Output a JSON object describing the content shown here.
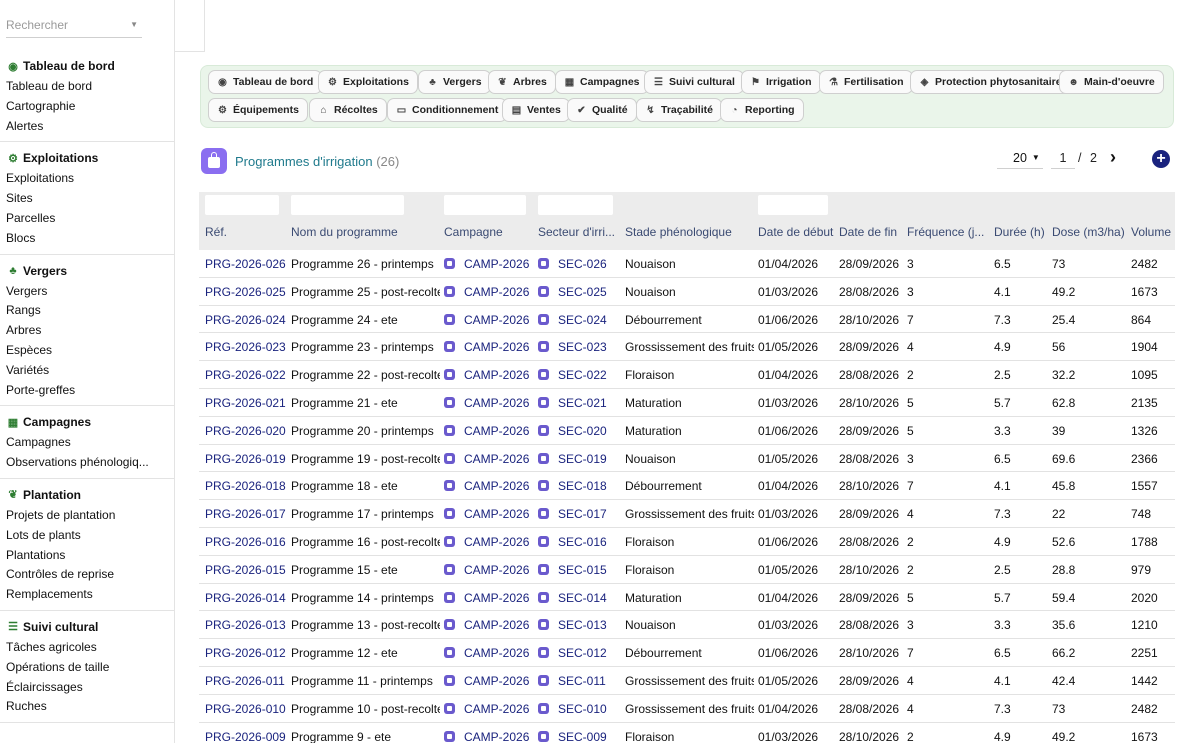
{
  "search": {
    "placeholder": "Rechercher"
  },
  "sidebar": {
    "sections": [
      {
        "title": "Tableau de bord",
        "icon": "dashboard-icon",
        "glyph": "◉",
        "items": [
          "Tableau de bord",
          "Cartographie",
          "Alertes"
        ]
      },
      {
        "title": "Exploitations",
        "icon": "tractor-icon",
        "glyph": "⚙",
        "items": [
          "Exploitations",
          "Sites",
          "Parcelles",
          "Blocs"
        ]
      },
      {
        "title": "Vergers",
        "icon": "tree-icon",
        "glyph": "♣",
        "items": [
          "Vergers",
          "Rangs",
          "Arbres",
          "Espèces",
          "Variétés",
          "Porte-greffes"
        ]
      },
      {
        "title": "Campagnes",
        "icon": "calendar-icon",
        "glyph": "▦",
        "items": [
          "Campagnes",
          "Observations phénologiq..."
        ]
      },
      {
        "title": "Plantation",
        "icon": "seedling-icon",
        "glyph": "❦",
        "items": [
          "Projets de plantation",
          "Lots de plants",
          "Plantations",
          "Contrôles de reprise",
          "Remplacements"
        ]
      },
      {
        "title": "Suivi cultural",
        "icon": "checklist-icon",
        "glyph": "☰",
        "items": [
          "Tâches agricoles",
          "Opérations de taille",
          "Éclaircissages",
          "Ruches"
        ]
      }
    ]
  },
  "modules": [
    {
      "label": "Tableau de bord",
      "icon": "dashboard-icon",
      "glyph": "◉"
    },
    {
      "label": "Exploitations",
      "icon": "tractor-icon",
      "glyph": "⚙"
    },
    {
      "label": "Vergers",
      "icon": "tree-icon",
      "glyph": "♣"
    },
    {
      "label": "Arbres",
      "icon": "seedling-icon",
      "glyph": "❦"
    },
    {
      "label": "Campagnes",
      "icon": "calendar-icon",
      "glyph": "▦"
    },
    {
      "label": "Suivi cultural",
      "icon": "checklist-icon",
      "glyph": "☰"
    },
    {
      "label": "Irrigation",
      "icon": "faucet-icon",
      "glyph": "⚑"
    },
    {
      "label": "Fertilisation",
      "icon": "flask-icon",
      "glyph": "⚗"
    },
    {
      "label": "Protection phytosanitaire",
      "icon": "shield-icon",
      "glyph": "◈"
    },
    {
      "label": "Main-d'oeuvre",
      "icon": "users-icon",
      "glyph": "☻"
    },
    {
      "label": "Équipements",
      "icon": "tractor-icon",
      "glyph": "⚙"
    },
    {
      "label": "Récoltes",
      "icon": "basket-icon",
      "glyph": "⌂"
    },
    {
      "label": "Conditionnement",
      "icon": "box-icon",
      "glyph": "▭"
    },
    {
      "label": "Ventes",
      "icon": "receipt-icon",
      "glyph": "▤"
    },
    {
      "label": "Qualité",
      "icon": "check-double-icon",
      "glyph": "✔"
    },
    {
      "label": "Traçabilité",
      "icon": "route-icon",
      "glyph": "↯"
    },
    {
      "label": "Reporting",
      "icon": "chart-pie-icon",
      "glyph": "◔"
    }
  ],
  "list": {
    "title": "Programmes d'irrigation",
    "count": "(26)",
    "page_size": "20",
    "page_current": "1",
    "page_sep": "/",
    "page_total": "2"
  },
  "table": {
    "columns": [
      "Réf.",
      "Nom du programme",
      "Campagne",
      "Secteur d'irri...",
      "Stade phénologique",
      "Date de début",
      "Date de fin",
      "Fréquence (j...",
      "Durée (h)",
      "Dose (m3/ha)",
      "Volume p"
    ],
    "rows": [
      [
        "PRG-2026-026",
        "Programme 26 - printemps",
        "CAMP-2026",
        "SEC-026",
        "Nouaison",
        "01/04/2026",
        "28/09/2026",
        "3",
        "6.5",
        "73",
        "2482"
      ],
      [
        "PRG-2026-025",
        "Programme 25 - post-recolte",
        "CAMP-2026",
        "SEC-025",
        "Nouaison",
        "01/03/2026",
        "28/08/2026",
        "3",
        "4.1",
        "49.2",
        "1673"
      ],
      [
        "PRG-2026-024",
        "Programme 24 - ete",
        "CAMP-2026",
        "SEC-024",
        "Débourrement",
        "01/06/2026",
        "28/10/2026",
        "7",
        "7.3",
        "25.4",
        "864"
      ],
      [
        "PRG-2026-023",
        "Programme 23 - printemps",
        "CAMP-2026",
        "SEC-023",
        "Grossissement des fruits",
        "01/05/2026",
        "28/09/2026",
        "4",
        "4.9",
        "56",
        "1904"
      ],
      [
        "PRG-2026-022",
        "Programme 22 - post-recolte",
        "CAMP-2026",
        "SEC-022",
        "Floraison",
        "01/04/2026",
        "28/08/2026",
        "2",
        "2.5",
        "32.2",
        "1095"
      ],
      [
        "PRG-2026-021",
        "Programme 21 - ete",
        "CAMP-2026",
        "SEC-021",
        "Maturation",
        "01/03/2026",
        "28/10/2026",
        "5",
        "5.7",
        "62.8",
        "2135"
      ],
      [
        "PRG-2026-020",
        "Programme 20 - printemps",
        "CAMP-2026",
        "SEC-020",
        "Maturation",
        "01/06/2026",
        "28/09/2026",
        "5",
        "3.3",
        "39",
        "1326"
      ],
      [
        "PRG-2026-019",
        "Programme 19 - post-recolte",
        "CAMP-2026",
        "SEC-019",
        "Nouaison",
        "01/05/2026",
        "28/08/2026",
        "3",
        "6.5",
        "69.6",
        "2366"
      ],
      [
        "PRG-2026-018",
        "Programme 18 - ete",
        "CAMP-2026",
        "SEC-018",
        "Débourrement",
        "01/04/2026",
        "28/10/2026",
        "7",
        "4.1",
        "45.8",
        "1557"
      ],
      [
        "PRG-2026-017",
        "Programme 17 - printemps",
        "CAMP-2026",
        "SEC-017",
        "Grossissement des fruits",
        "01/03/2026",
        "28/09/2026",
        "4",
        "7.3",
        "22",
        "748"
      ],
      [
        "PRG-2026-016",
        "Programme 16 - post-recolte",
        "CAMP-2026",
        "SEC-016",
        "Floraison",
        "01/06/2026",
        "28/08/2026",
        "2",
        "4.9",
        "52.6",
        "1788"
      ],
      [
        "PRG-2026-015",
        "Programme 15 - ete",
        "CAMP-2026",
        "SEC-015",
        "Floraison",
        "01/05/2026",
        "28/10/2026",
        "2",
        "2.5",
        "28.8",
        "979"
      ],
      [
        "PRG-2026-014",
        "Programme 14 - printemps",
        "CAMP-2026",
        "SEC-014",
        "Maturation",
        "01/04/2026",
        "28/09/2026",
        "5",
        "5.7",
        "59.4",
        "2020"
      ],
      [
        "PRG-2026-013",
        "Programme 13 - post-recolte",
        "CAMP-2026",
        "SEC-013",
        "Nouaison",
        "01/03/2026",
        "28/08/2026",
        "3",
        "3.3",
        "35.6",
        "1210"
      ],
      [
        "PRG-2026-012",
        "Programme 12 - ete",
        "CAMP-2026",
        "SEC-012",
        "Débourrement",
        "01/06/2026",
        "28/10/2026",
        "7",
        "6.5",
        "66.2",
        "2251"
      ],
      [
        "PRG-2026-011",
        "Programme 11 - printemps",
        "CAMP-2026",
        "SEC-011",
        "Grossissement des fruits",
        "01/05/2026",
        "28/09/2026",
        "4",
        "4.1",
        "42.4",
        "1442"
      ],
      [
        "PRG-2026-010",
        "Programme 10 - post-recolte",
        "CAMP-2026",
        "SEC-010",
        "Grossissement des fruits",
        "01/04/2026",
        "28/08/2026",
        "4",
        "7.3",
        "73",
        "2482"
      ],
      [
        "PRG-2026-009",
        "Programme 9 - ete",
        "CAMP-2026",
        "SEC-009",
        "Floraison",
        "01/03/2026",
        "28/10/2026",
        "2",
        "4.9",
        "49.2",
        "1673"
      ]
    ]
  },
  "colors": {
    "accent": "#1a237e",
    "title": "#1f7a8c",
    "module_panel": "#eaf5ea",
    "list_icon": "#8a6ef0"
  }
}
